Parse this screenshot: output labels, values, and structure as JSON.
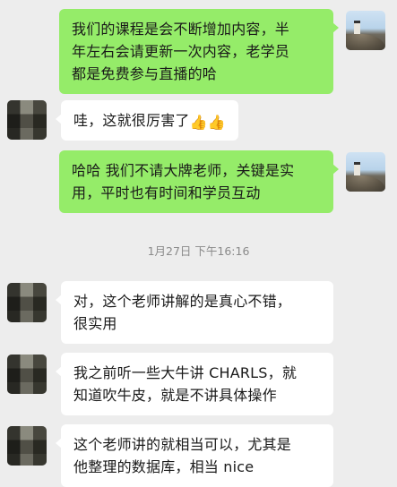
{
  "messages": [
    {
      "side": "out",
      "lines": [
        "我们的课程是会不断增加内容，半",
        "年左右会请更新一次内容，老学员",
        "都是免费参与直播的哈"
      ]
    },
    {
      "side": "in",
      "text": "哇，这就很厉害了",
      "emoji": [
        "👍",
        "👍"
      ],
      "emoji_names": [
        "thumbs-up-icon",
        "thumbs-up-icon"
      ]
    },
    {
      "side": "out",
      "lines": [
        "哈哈 我们不请大牌老师，关键是实",
        "用，平时也有时间和学员互动"
      ]
    },
    {
      "side": "in",
      "lines": [
        "对，这个老师讲解的是真心不错，",
        "很实用"
      ]
    },
    {
      "side": "in",
      "lines": [
        "我之前听一些大牛讲 CHARLS，就",
        "知道吹牛皮，就是不讲具体操作"
      ]
    },
    {
      "side": "in",
      "lines": [
        "这个老师讲的就相当可以，尤其是",
        "他整理的数据库，相当 nice"
      ]
    }
  ],
  "timestamp": "1月27日 下午16:16",
  "colors": {
    "background": "#ededed",
    "outgoing_bubble": "#95ec69",
    "incoming_bubble": "#ffffff",
    "text": "#191919",
    "timestamp": "#8a8a8a"
  }
}
